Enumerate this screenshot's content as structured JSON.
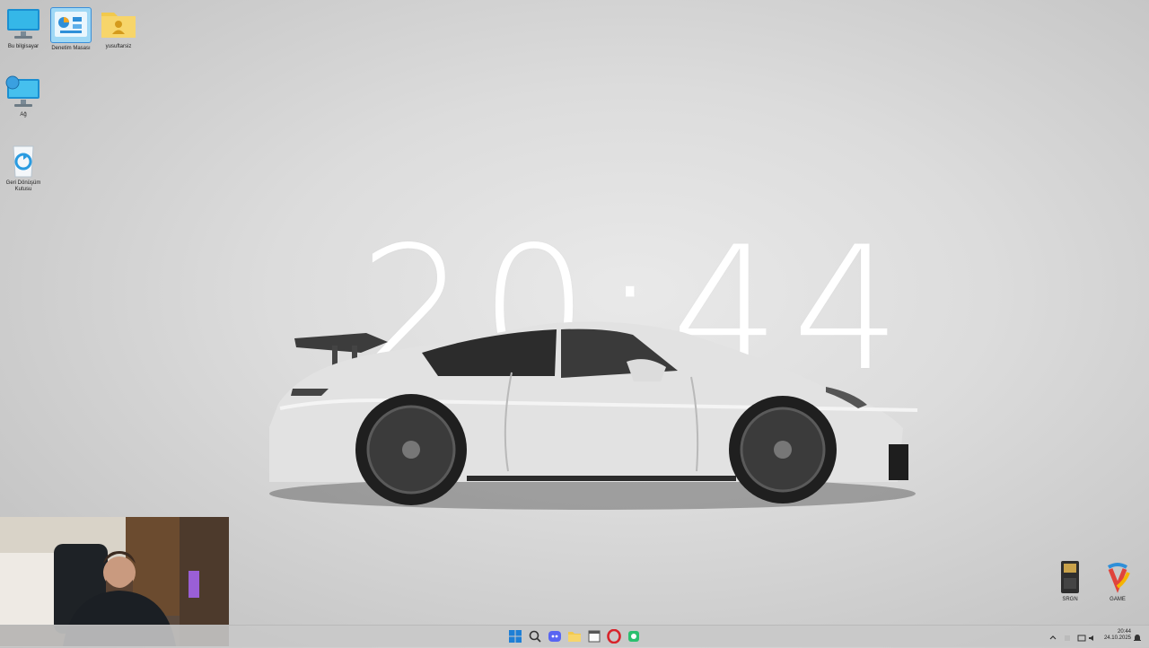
{
  "desktop_icons": [
    {
      "label": "Bu bilgisayar",
      "icon": "computer-icon"
    },
    {
      "label": "Denetim Masası",
      "icon": "control-panel-icon"
    },
    {
      "label": "yusuftarsiz",
      "icon": "user-folder-icon"
    },
    {
      "label": "Ağ",
      "icon": "network-icon"
    },
    {
      "label": "Geri Dönüşüm Kutusu",
      "icon": "recycle-bin-icon"
    }
  ],
  "desktop_icons_right": [
    {
      "label": "SRGN",
      "icon": "sd-card-icon"
    },
    {
      "label": "GAME",
      "icon": "game-logo-icon"
    }
  ],
  "wallpaper": {
    "clock_text": "20:44"
  },
  "taskbar": {
    "apps": [
      "start-icon",
      "search-icon",
      "discord-icon",
      "file-explorer-icon",
      "calendar-app-icon",
      "opera-icon",
      "android-studio-icon"
    ],
    "tray": {
      "time": "20:44",
      "date": "24.10.2025"
    }
  },
  "colors": {
    "taskbar": "#c8c8c8",
    "accent_blue": "#2f8fd8",
    "opera_red": "#d8232a"
  }
}
